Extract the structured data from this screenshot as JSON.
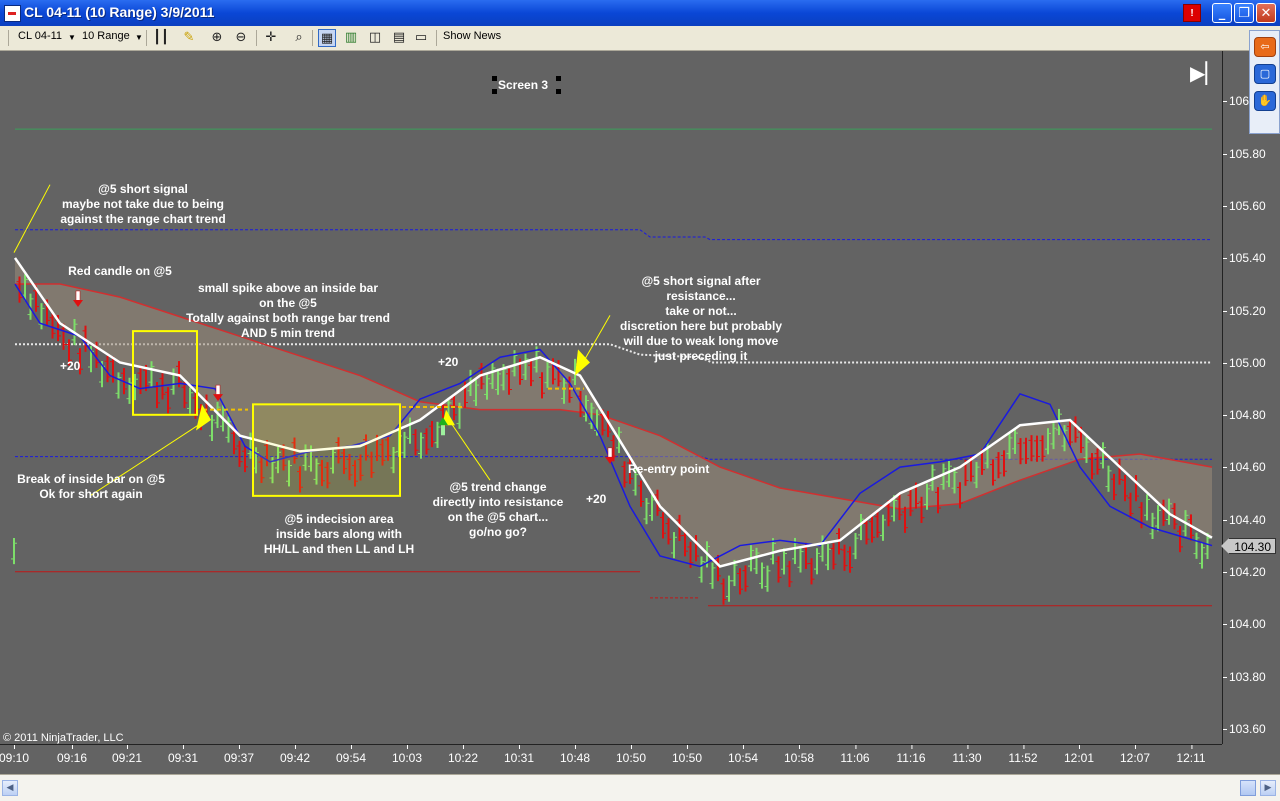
{
  "window": {
    "title": "CL 04-11 (10 Range)  3/9/2011",
    "alert_label": "!",
    "minimize": "_",
    "maximize": "❐",
    "close": "✕"
  },
  "toolbar": {
    "instrument": "CL 04-11",
    "period": "10 Range",
    "show_news": "Show News"
  },
  "chart": {
    "screen_label": "Screen 3",
    "copyright": "© 2011 NinjaTrader, LLC",
    "current_price": "104.30",
    "y_ticks": [
      "106",
      "105.80",
      "105.60",
      "105.40",
      "105.20",
      "105.00",
      "104.80",
      "104.60",
      "104.40",
      "104.20",
      "104.00",
      "103.80",
      "103.60"
    ],
    "x_ticks": [
      "09:10",
      "09:16",
      "09:21",
      "09:31",
      "09:37",
      "09:42",
      "09:54",
      "10:03",
      "10:22",
      "10:31",
      "10:48",
      "10:50",
      "10:50",
      "10:54",
      "10:58",
      "11:06",
      "11:16",
      "11:30",
      "11:52",
      "12:01",
      "12:07",
      "12:11"
    ],
    "colors": {
      "background": "#636363",
      "up_bar": "#7dde6a",
      "down_bar": "#e01010",
      "ema": "#1a1ae0",
      "sma": "#ffffff",
      "annotation_box": "#ffff00"
    }
  },
  "annotations": {
    "short_signal": "@5 short signal\nmaybe not take due to being\nagainst the range chart trend",
    "red_candle": "Red candle on @5",
    "small_spike": "small spike above an inside bar\non the @5\nTotally against both range bar trend\nAND 5 min trend",
    "plus20_a": "+20",
    "plus20_b": "+20",
    "plus20_c": "+20",
    "break_inside": "Break of inside bar on @5\nOk for short again",
    "indecision": "@5 indecision area\ninside bars along with\nHH/LL and then LL and LH",
    "trend_change": "@5 trend change\ndirectly into resistance\non the @5 chart...\ngo/no go?",
    "short_after_res": "@5 short signal after\nresistance...\ntake or not...\ndiscretion here but probably\nwill due to weak long move\njust preceding it",
    "reentry": "Re-entry point"
  }
}
